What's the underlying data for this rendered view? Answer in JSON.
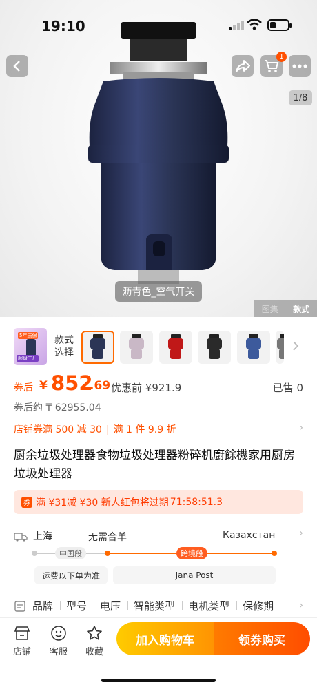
{
  "status_bar": {
    "time": "19:10"
  },
  "gallery": {
    "page_indicator": "1/8",
    "variant_tag": "沥青色_空气开关",
    "tabs": [
      "图集",
      "款式"
    ],
    "active_tab": "款式",
    "cart_badge": "1"
  },
  "style_strip": {
    "label_line1": "款式",
    "label_line2": "选择",
    "thumb0_banner_top": "5年质保",
    "thumb0_banner_bottom": "超级工厂",
    "selected_index": 0,
    "thumb_colors": [
      "#2b3556",
      "#c9b8c6",
      "#c01818",
      "#2a2a2a",
      "#3d5a9c",
      "#777777"
    ]
  },
  "price": {
    "after_label": "券后",
    "currency": "¥",
    "integer": "852",
    "decimal": ".69",
    "before_label": "优惠前",
    "before_value": "¥921.9",
    "sold_label": "已售",
    "sold_count": "0",
    "approx": "券后约 ₸ 62955.04"
  },
  "coupons": {
    "shop": "店铺券满 500 减 30",
    "discount": "满 1 件 9.9 折"
  },
  "title": "厨余垃圾处理器食物垃圾处理器粉碎机廚餘機家用厨房垃圾处理器",
  "red_packet": {
    "icon": "券",
    "text": "满 ¥31减 ¥30 新人红包将过期",
    "countdown": "71:58:51.3"
  },
  "shipping": {
    "from": "上海",
    "merge": "无需合单",
    "to": "Казахстан",
    "segment_cn": "中国段",
    "segment_cross": "跨境段",
    "note_cn": "运费以下单为准",
    "carrier": "Jana Post"
  },
  "specs": [
    "品牌",
    "型号",
    "电压",
    "智能类型",
    "电机类型",
    "保修期"
  ],
  "bottom_bar": {
    "shop": "店铺",
    "service": "客服",
    "favorite": "收藏",
    "add_cart": "加入购物车",
    "buy": "领券购买"
  },
  "colors": {
    "accent": "#ff5000",
    "product_body": "#2b3556"
  }
}
